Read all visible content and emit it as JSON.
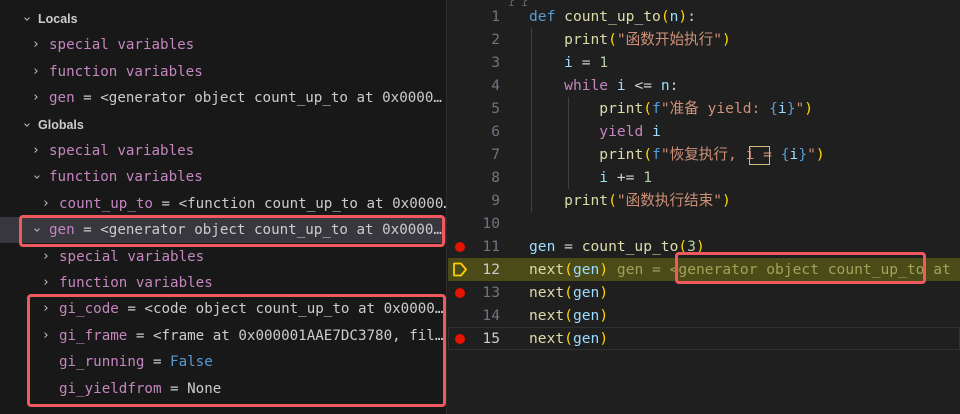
{
  "variables_panel": {
    "locals": {
      "label": "Locals",
      "special": "special variables",
      "function": "function variables",
      "gen_name": "gen",
      "gen_value": "<generator object count_up_to at 0x0000…"
    },
    "globals": {
      "label": "Globals",
      "special": "special variables",
      "function": "function variables",
      "count_up_to_name": "count_up_to",
      "count_up_to_value": "<function count_up_to at 0x0000…",
      "gen_name": "gen",
      "gen_value": "<generator object count_up_to at 0x0000…",
      "gen_special": "special variables",
      "gen_function": "function variables",
      "gi_code_name": "gi_code",
      "gi_code_value": "<code object count_up_to at 0x0000…",
      "gi_frame_name": "gi_frame",
      "gi_frame_value": "<frame at 0x000001AAE7DC3780, fil…",
      "gi_running_name": "gi_running",
      "gi_running_value": "False",
      "gi_yieldfrom_name": "gi_yieldfrom",
      "gi_yieldfrom_value": "None"
    },
    "equals": " = "
  },
  "editor": {
    "line_numbers": [
      "1",
      "2",
      "3",
      "4",
      "5",
      "6",
      "7",
      "8",
      "9",
      "10",
      "11",
      "12",
      "13",
      "14",
      "15"
    ],
    "breakpoint_lines": [
      11,
      13,
      15
    ],
    "current_line": 12,
    "tokens": {
      "kw_def": "def",
      "fn_count_up_to": "count_up_to",
      "param_n": "n",
      "print": "print",
      "str_start": "\"函数开始执行\"",
      "var_i": "i",
      "num_1": "1",
      "kw_while": "while",
      "op_le": " <= ",
      "f_prefix": "f",
      "str_prepare_a": "\"准备 yield: ",
      "str_prepare_b": "\"",
      "brace_i": "{i}",
      "kw_yield": "yield",
      "str_resume_a": "\"恢复执行",
      "str_resume_comma": ",",
      "str_resume_b": " i = ",
      "op_pluseq": " += ",
      "str_end": "\"函数执行结束\"",
      "gen": "gen",
      "op_eq": " = ",
      "num_3": "3",
      "next": "next",
      "inline_value": "gen = <generator object count_up_to at 0x"
    }
  }
}
